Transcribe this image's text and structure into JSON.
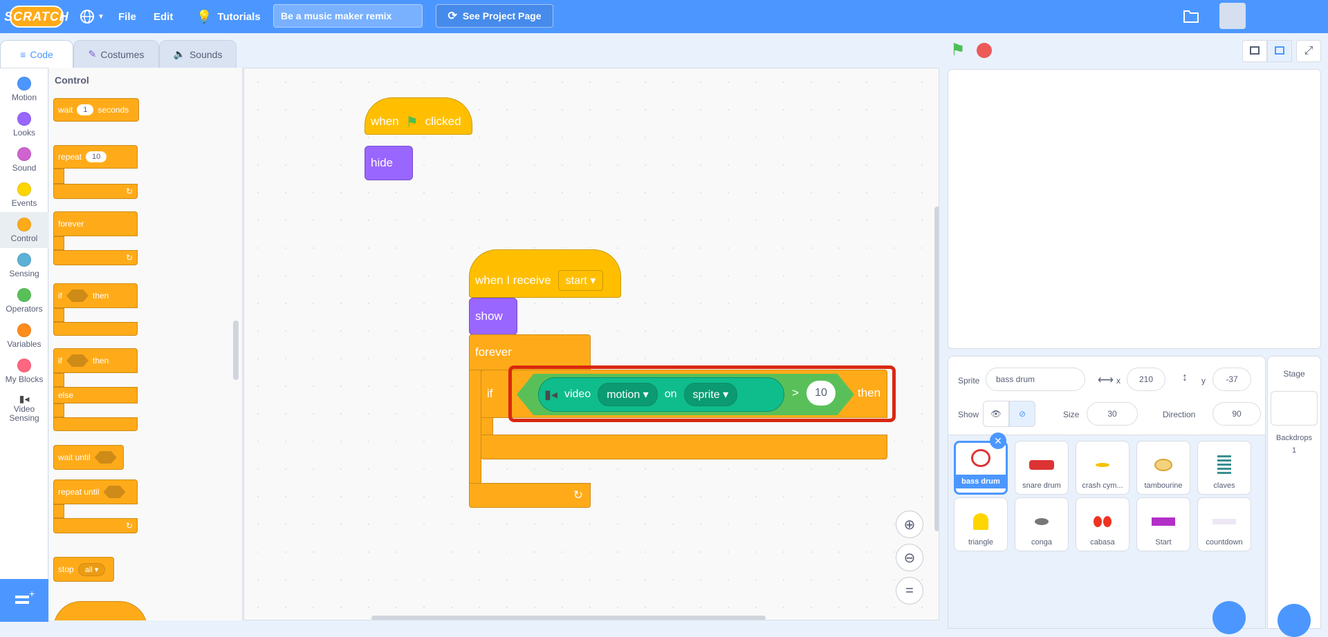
{
  "menubar": {
    "logo": "SCRATCH",
    "file": "File",
    "edit": "Edit",
    "tutorials": "Tutorials",
    "project_title": "Be a music maker remix",
    "see_project": "See Project Page"
  },
  "tabs": [
    {
      "label": "Code"
    },
    {
      "label": "Costumes"
    },
    {
      "label": "Sounds"
    }
  ],
  "categories": [
    {
      "label": "Motion",
      "color": "#4c97ff"
    },
    {
      "label": "Looks",
      "color": "#9966ff"
    },
    {
      "label": "Sound",
      "color": "#cf63cf"
    },
    {
      "label": "Events",
      "color": "#ffd500"
    },
    {
      "label": "Control",
      "color": "#ffab19"
    },
    {
      "label": "Sensing",
      "color": "#5cb1d6"
    },
    {
      "label": "Operators",
      "color": "#59c059"
    },
    {
      "label": "Variables",
      "color": "#ff8c1a"
    },
    {
      "label": "My Blocks",
      "color": "#ff6680"
    },
    {
      "label": "Video Sensing",
      "color": "#0fbd8c"
    }
  ],
  "flyout": {
    "title": "Control",
    "wait": "wait",
    "wait_val": "1",
    "seconds": "seconds",
    "repeat": "repeat",
    "repeat_val": "10",
    "forever": "forever",
    "if": "if",
    "then": "then",
    "if2": "if",
    "then2": "then",
    "else": "else",
    "wait_until": "wait until",
    "repeat_until": "repeat until",
    "stop": "stop",
    "stop_val": "all"
  },
  "script1": {
    "when": "when",
    "clicked": "clicked",
    "hide": "hide"
  },
  "script2": {
    "when_receive": "when I receive",
    "message": "start",
    "show": "show",
    "forever": "forever",
    "if": "if",
    "video": "video",
    "attribute": "motion",
    "on": "on",
    "subject": "sprite",
    "op": ">",
    "value": "10",
    "then": "then"
  },
  "zoom": {
    "reset": "="
  },
  "sprite_info": {
    "sprite_label": "Sprite",
    "sprite_name": "bass drum",
    "x_label": "x",
    "x": "210",
    "y_label": "y",
    "y": "-37",
    "show_label": "Show",
    "size_label": "Size",
    "size": "30",
    "direction_label": "Direction",
    "direction": "90"
  },
  "sprites": [
    {
      "name": "bass drum"
    },
    {
      "name": "snare drum"
    },
    {
      "name": "crash cym..."
    },
    {
      "name": "tambourine"
    },
    {
      "name": "claves"
    },
    {
      "name": "triangle"
    },
    {
      "name": "conga"
    },
    {
      "name": "cabasa"
    },
    {
      "name": "Start"
    },
    {
      "name": "countdown"
    }
  ],
  "stage_pane": {
    "title": "Stage",
    "backdrops_label": "Backdrops",
    "backdrops_count": "1"
  }
}
